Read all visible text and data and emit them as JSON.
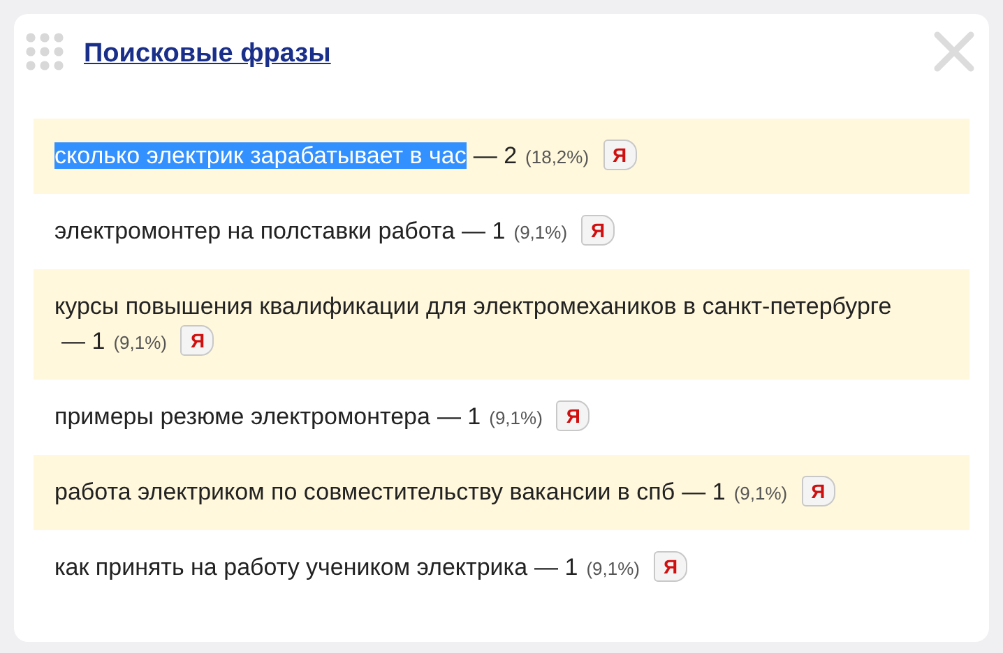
{
  "panel": {
    "title": "Поисковые фразы"
  },
  "phrases": [
    {
      "text": "сколько электрик зарабатывает в час",
      "count": "— 2",
      "share": "(18,2%)",
      "badge": "Я",
      "selected": true
    },
    {
      "text": "электромонтер на полставки работа",
      "count": "— 1",
      "share": "(9,1%)",
      "badge": "Я",
      "selected": false
    },
    {
      "text": "курсы повышения квалификации для электромехаников в санкт-петербурге",
      "count": "— 1",
      "share": "(9,1%)",
      "badge": "Я",
      "selected": false
    },
    {
      "text": "примеры резюме электромонтера",
      "count": "— 1",
      "share": "(9,1%)",
      "badge": "Я",
      "selected": false
    },
    {
      "text": "работа электриком по совместительству вакансии в спб",
      "count": "— 1",
      "share": "(9,1%)",
      "badge": "Я",
      "selected": false
    },
    {
      "text": "как принять на работу учеником электрика",
      "count": "— 1",
      "share": "(9,1%)",
      "badge": "Я",
      "selected": false
    }
  ]
}
